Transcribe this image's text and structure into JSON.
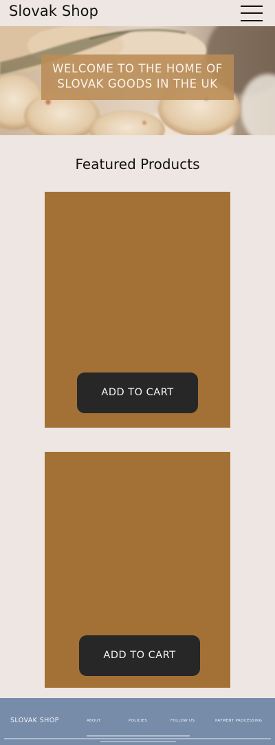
{
  "header": {
    "brand": "Slovak Shop",
    "menu_icon": "hamburger-menu-icon"
  },
  "hero": {
    "banner_line1": "WELCOME TO THE HOME OF",
    "banner_line2": "SLOVAK GOODS IN THE UK",
    "image": "pastries-photo"
  },
  "featured": {
    "title": "Featured Products",
    "products": [
      {
        "button_label": "ADD TO CART"
      },
      {
        "button_label": "ADD TO CART"
      }
    ]
  },
  "footer": {
    "brand": "SLOVAK SHOP",
    "links": [
      "ABOUT",
      "POLICIES",
      "FOLLOW US",
      "PAYMENT PROCESSING"
    ]
  },
  "colors": {
    "page_bg": "#ede6e2",
    "card": "#a37135",
    "button": "#272727",
    "footer": "#768ca9",
    "hero_banner": "#ba8c57"
  }
}
